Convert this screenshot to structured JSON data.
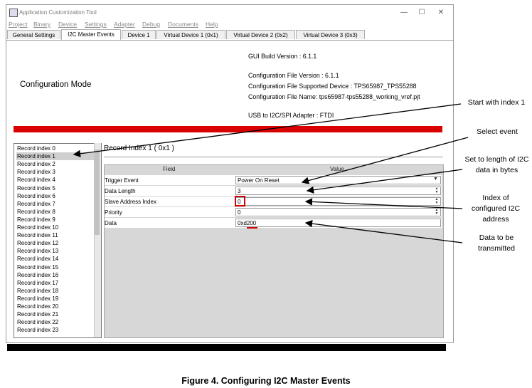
{
  "window": {
    "title": "Application Customization Tool",
    "controls": [
      "—",
      "☐",
      "✕"
    ]
  },
  "menu": [
    "Project",
    "Binary",
    "Device",
    "Settings",
    "Adapter",
    "Debug",
    "Documents",
    "Help"
  ],
  "tabs": [
    "General Settings",
    "I2C Master Events",
    "Device 1",
    "Virtual Device 1 (0x1)",
    "Virtual Device 2 (0x2)",
    "Virtual Device 3 (0x3)"
  ],
  "active_tab": "I2C Master Events",
  "info": {
    "gui_build": "GUI Build Version : 6.1.1",
    "config_version": "Configuration File Version : 6.1.1",
    "supported_device": "Configuration File Supported Device : TPS65987_TPS55288",
    "file_name": "Configuration File Name: tps65987-tps55288_working_vref.pjt",
    "adapter": "USB to I2C/SPI Adapter : FTDI"
  },
  "mode_label": "Configuration Mode",
  "records": [
    "Record index 0",
    "Record index 1",
    "Record index 2",
    "Record index 3",
    "Record index 4",
    "Record index 5",
    "Record index 6",
    "Record index 7",
    "Record index 8",
    "Record index 9",
    "Record index 10",
    "Record index 11",
    "Record index 12",
    "Record index 13",
    "Record index 14",
    "Record index 15",
    "Record index 16",
    "Record index 17",
    "Record index 18",
    "Record index 19",
    "Record index 20",
    "Record index 21",
    "Record index 22",
    "Record index 23"
  ],
  "selected_record": "Record index 1",
  "record_title": "Record Index 1   ( 0x1 )",
  "grid": {
    "headers": [
      "Field",
      "Value"
    ],
    "rows": [
      {
        "field": "Trigger Event",
        "value": "Power On Reset"
      },
      {
        "field": "Data Length",
        "value": "3"
      },
      {
        "field": "Slave Address Index",
        "value": "0"
      },
      {
        "field": "Priority",
        "value": "0"
      },
      {
        "field": "Data",
        "value": "0xd200"
      }
    ]
  },
  "callouts": {
    "start": "Start with index 1",
    "select": "Select event",
    "length": "Set to length of I2C data in bytes",
    "index": "Index of configured I2C address",
    "data": "Data to be transmitted"
  },
  "caption": "Figure 4. Configuring I2C Master Events",
  "colors": {
    "red_bar": "#d90000",
    "selection": "#cfcfcf",
    "highlight": "#d00000"
  }
}
